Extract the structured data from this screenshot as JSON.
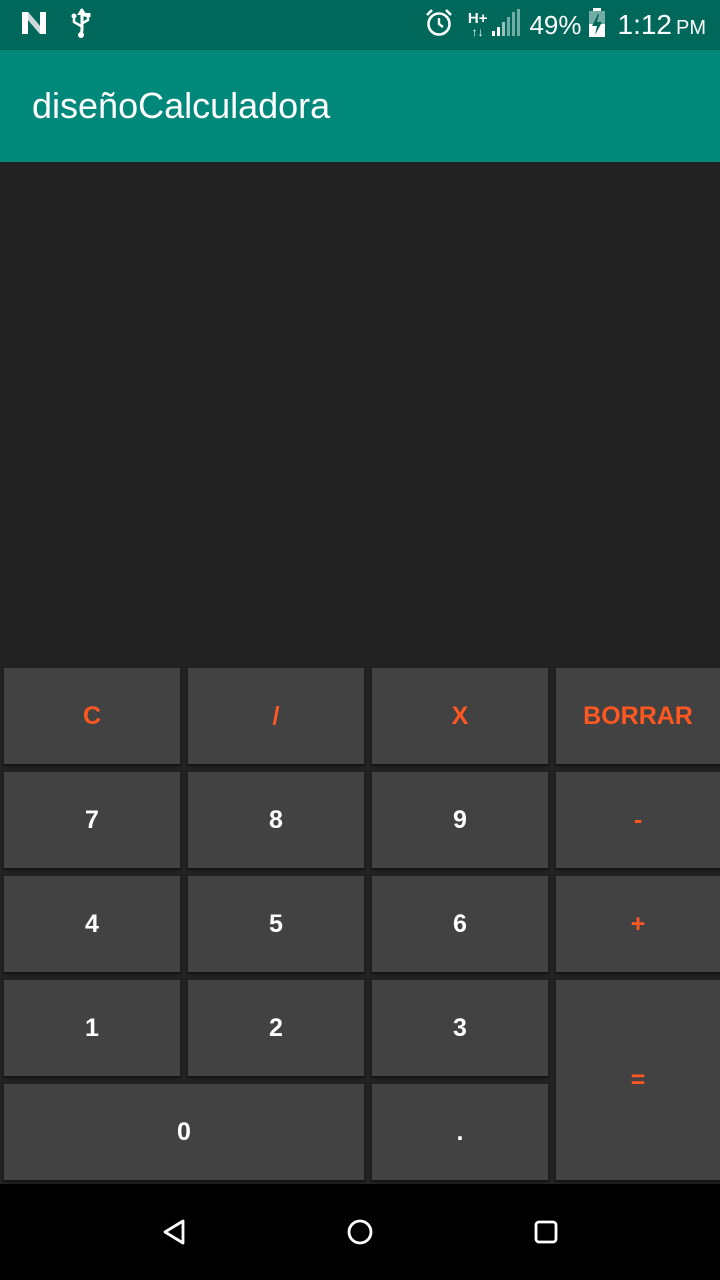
{
  "status_bar": {
    "battery_percent": "49%",
    "time": "1:12",
    "ampm": "PM",
    "network": "H+",
    "icons": [
      "n-notification-icon",
      "usb-icon",
      "alarm-icon",
      "hplus-data-icon",
      "signal-icon",
      "battery-charging-icon"
    ]
  },
  "app_bar": {
    "title": "diseñoCalculadora"
  },
  "display": {
    "value": ""
  },
  "keys": {
    "c": "C",
    "divide": "/",
    "multiply": "X",
    "borrar": "BORRAR",
    "seven": "7",
    "eight": "8",
    "nine": "9",
    "minus": "-",
    "four": "4",
    "five": "5",
    "six": "6",
    "plus": "+",
    "one": "1",
    "two": "2",
    "three": "3",
    "equals": "=",
    "zero": "0",
    "dot": "."
  },
  "nav_bar": {
    "icons": [
      "back-icon",
      "home-icon",
      "recents-icon"
    ]
  },
  "colors": {
    "status_bar": "#00675b",
    "app_bar": "#00897b",
    "background": "#222222",
    "key": "#424242",
    "operator_text": "#ff5722",
    "digit_text": "#ffffff"
  }
}
